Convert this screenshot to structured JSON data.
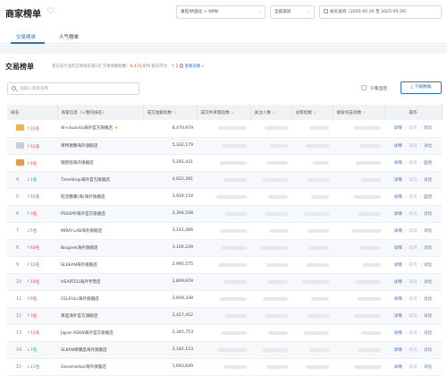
{
  "header": {
    "title": "商家榜单",
    "heart_icon": "heart-outline-icon",
    "category_select": "鼻腔/抗菌化 > NMN",
    "channel_select": "全部渠道",
    "date_select": "按天查询（2025-05-26 至 2025-05-26）"
  },
  "tabs": [
    {
      "label": "交易榜单",
      "active": true
    },
    {
      "label": "人气榜单",
      "active": false
    }
  ],
  "section": {
    "title": "交易榜单",
    "desc_prefix": "您在该行业的交易排名第1名 交易金额指数：",
    "desc_value": "8,470,979",
    "desc_mid": "排名环比：",
    "desc_change": "1",
    "desc_link": "查看详情 »"
  },
  "search": {
    "placeholder": "请输入商家名称",
    "value": ""
  },
  "filters": {
    "only_monitor_label": "只看监控",
    "download_label": "下载数据"
  },
  "table": {
    "headers": {
      "rank": "排名",
      "shop": "商家信息（",
      "shop_mine": "我的排名）",
      "trade": "成交金额指数",
      "avg": "成交件单量指数",
      "visitors": "关注人数",
      "visits": "访客指数",
      "search": "搜索点击指数",
      "ops": "操作"
    },
    "rows": [
      {
        "rank": "1",
        "medal": "gold",
        "dir": "up",
        "change": "22名",
        "shop": "W+duanita海外官方旗舰店",
        "mine": "★",
        "trade": "8,470,979",
        "ops": [
          "详情",
          "取消",
          "对比"
        ]
      },
      {
        "rank": "2",
        "medal": "silver",
        "dir": "up",
        "change": "12名",
        "shop": "莱特德健海外旗舰店",
        "mine": "",
        "trade": "5,332,179",
        "ops": [
          "详情",
          "取消",
          "对比"
        ]
      },
      {
        "rank": "3",
        "medal": "bronze",
        "dir": "up",
        "change": "8名",
        "shop": "瑞塔控海外旗舰店",
        "mine": "",
        "trade": "5,291,431",
        "ops": [
          "详情",
          "取消",
          "监控"
        ]
      },
      {
        "rank": "4",
        "medal": "",
        "dir": "down",
        "change": "1名",
        "shop": "TimeShop海外官方旗舰店",
        "mine": "",
        "trade": "4,622,281",
        "ops": [
          "详情",
          "取消",
          "对比"
        ]
      },
      {
        "rank": "5",
        "medal": "",
        "dir": "up",
        "change": "12名",
        "shop": "旺治整康(海)海外旗舰店",
        "mine": "",
        "trade": "3,934,154",
        "ops": [
          "详情",
          "取消",
          "监控"
        ]
      },
      {
        "rank": "6",
        "medal": "",
        "dir": "up",
        "change": "3名",
        "shop": "PSSOPP海外官方旗舰店",
        "mine": "",
        "trade": "3,394,548",
        "ops": [
          "详情",
          "取消",
          "对比"
        ]
      },
      {
        "rank": "7",
        "medal": "",
        "dir": "down",
        "change": "5名",
        "shop": "MIRAI LAB海外旗舰店",
        "mine": "",
        "trade": "3,141,286",
        "ops": [
          "详情",
          "取消",
          "对比"
        ]
      },
      {
        "rank": "8",
        "medal": "",
        "dir": "up",
        "change": "48名",
        "shop": "Biogeek海外旗舰店",
        "mine": "",
        "trade": "3,100,239",
        "ops": [
          "详情",
          "取消",
          "对比"
        ]
      },
      {
        "rank": "9",
        "medal": "",
        "dir": "up",
        "change": "12名",
        "shop": "SLEKAN海外旗舰店",
        "mine": "",
        "trade": "2,995,575",
        "ops": [
          "详情",
          "取消",
          "对比"
        ]
      },
      {
        "rank": "10",
        "medal": "",
        "dir": "up",
        "change": "18名",
        "shop": "HEARTED海外专营店",
        "mine": "",
        "trade": "2,809,978",
        "ops": [
          "详情",
          "取消",
          "对比"
        ]
      },
      {
        "rank": "11",
        "medal": "",
        "dir": "up",
        "change": "9名",
        "shop": "CELFULL海外旗舰店",
        "mine": "",
        "trade": "2,609,338",
        "ops": [
          "详情",
          "取消",
          "对比"
        ]
      },
      {
        "rank": "12",
        "medal": "",
        "dir": "up",
        "change": "3名",
        "shop": "莱选海外官方旗舰店",
        "mine": "",
        "trade": "2,427,452",
        "ops": [
          "详情",
          "取消",
          "对比"
        ]
      },
      {
        "rank": "13",
        "medal": "",
        "dir": "up",
        "change": "13名",
        "shop": "Japan KSKN海外官方旗舰店",
        "mine": "",
        "trade": "2,345,753",
        "ops": [
          "详情",
          "取消",
          "对比"
        ]
      },
      {
        "rank": "14",
        "medal": "",
        "dir": "down",
        "change": "7名",
        "shop": "SLKAN保健品海外旗舰店",
        "mine": "",
        "trade": "2,182,153",
        "ops": [
          "详情",
          "取消",
          "对比"
        ]
      },
      {
        "rank": "15",
        "medal": "",
        "dir": "down",
        "change": "11名",
        "shop": "GeneHarbor海外旗舰店",
        "mine": "",
        "trade": "1,693,649",
        "ops": [
          "详情",
          "取消",
          "对比"
        ]
      }
    ]
  },
  "colors": {
    "accent": "#2f6fd6",
    "up": "#e5484d",
    "down": "#2ea866",
    "highlight": "#e0592a"
  }
}
